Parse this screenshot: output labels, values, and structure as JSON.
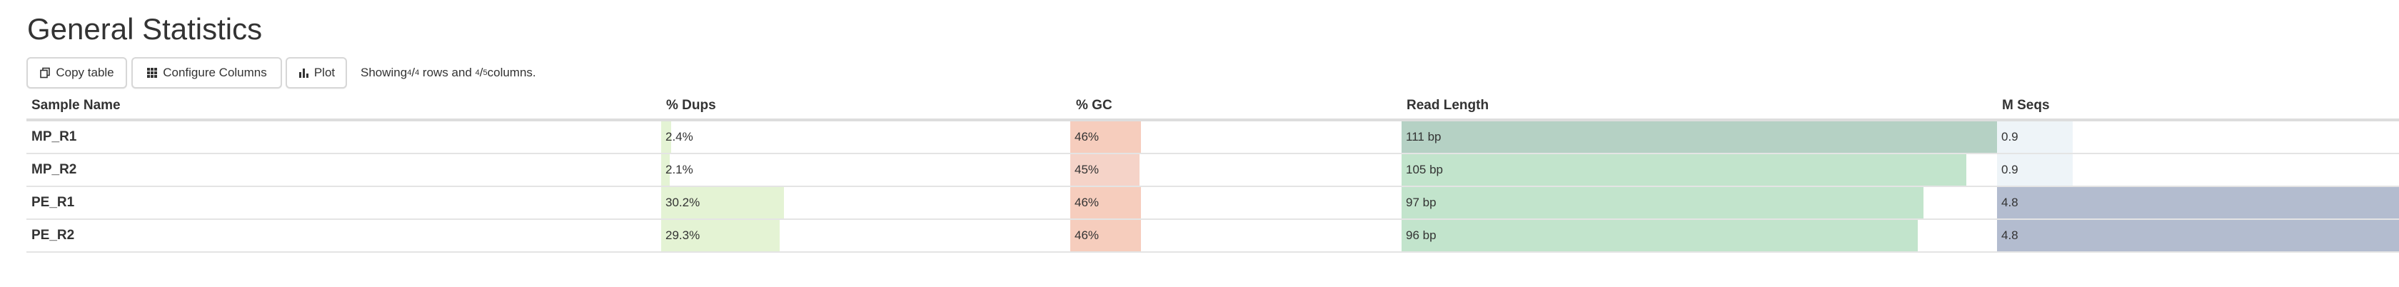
{
  "title": "General Statistics",
  "toolbar": {
    "copy_label": "Copy table",
    "configure_label": "Configure Columns",
    "plot_label": "Plot",
    "showing_prefix": "Showing ",
    "rows_shown": "4",
    "rows_total": "4",
    "rows_suffix": " rows and ",
    "cols_shown": "4",
    "cols_total": "5",
    "cols_suffix": " columns."
  },
  "table": {
    "headers": {
      "sample": "Sample Name",
      "dups": "% Dups",
      "gc": "% GC",
      "read_length": "Read Length",
      "mseqs": "M Seqs"
    },
    "rows": [
      {
        "name": "MP_R1",
        "dups": {
          "text": "2.4%",
          "fraction": 0.024
        },
        "gc": {
          "text": "46%",
          "fraction": 0.46
        },
        "read_length": {
          "text": "111 bp",
          "fraction": 1.0
        },
        "mseqs": {
          "text": "0.9",
          "fraction": 0.1875
        }
      },
      {
        "name": "MP_R2",
        "dups": {
          "text": "2.1%",
          "fraction": 0.021
        },
        "gc": {
          "text": "45%",
          "fraction": 0.45
        },
        "read_length": {
          "text": "105 bp",
          "fraction": 0.946
        },
        "mseqs": {
          "text": "0.9",
          "fraction": 0.1875
        }
      },
      {
        "name": "PE_R1",
        "dups": {
          "text": "30.2%",
          "fraction": 0.302
        },
        "gc": {
          "text": "46%",
          "fraction": 0.46
        },
        "read_length": {
          "text": "97 bp",
          "fraction": 0.874
        },
        "mseqs": {
          "text": "4.8",
          "fraction": 1.0
        }
      },
      {
        "name": "PE_R2",
        "dups": {
          "text": "29.3%",
          "fraction": 0.293
        },
        "gc": {
          "text": "46%",
          "fraction": 0.46
        },
        "read_length": {
          "text": "96 bp",
          "fraction": 0.865
        },
        "mseqs": {
          "text": "4.8",
          "fraction": 1.0
        }
      }
    ]
  },
  "colors": {
    "dups_bar": "#e4f3d4",
    "gc_bar": "#f6cdbd",
    "gc_bar_light": "#f5d3c8",
    "read_length_bar_high": "#b5d1c4",
    "read_length_bar": "#c2e4cc",
    "mseqs_bar_low": "#eef4f8",
    "mseqs_bar_high": "#b3bccf"
  },
  "icons": {
    "copy": "copy-icon",
    "configure": "grid-icon",
    "plot": "bar-chart-icon"
  }
}
